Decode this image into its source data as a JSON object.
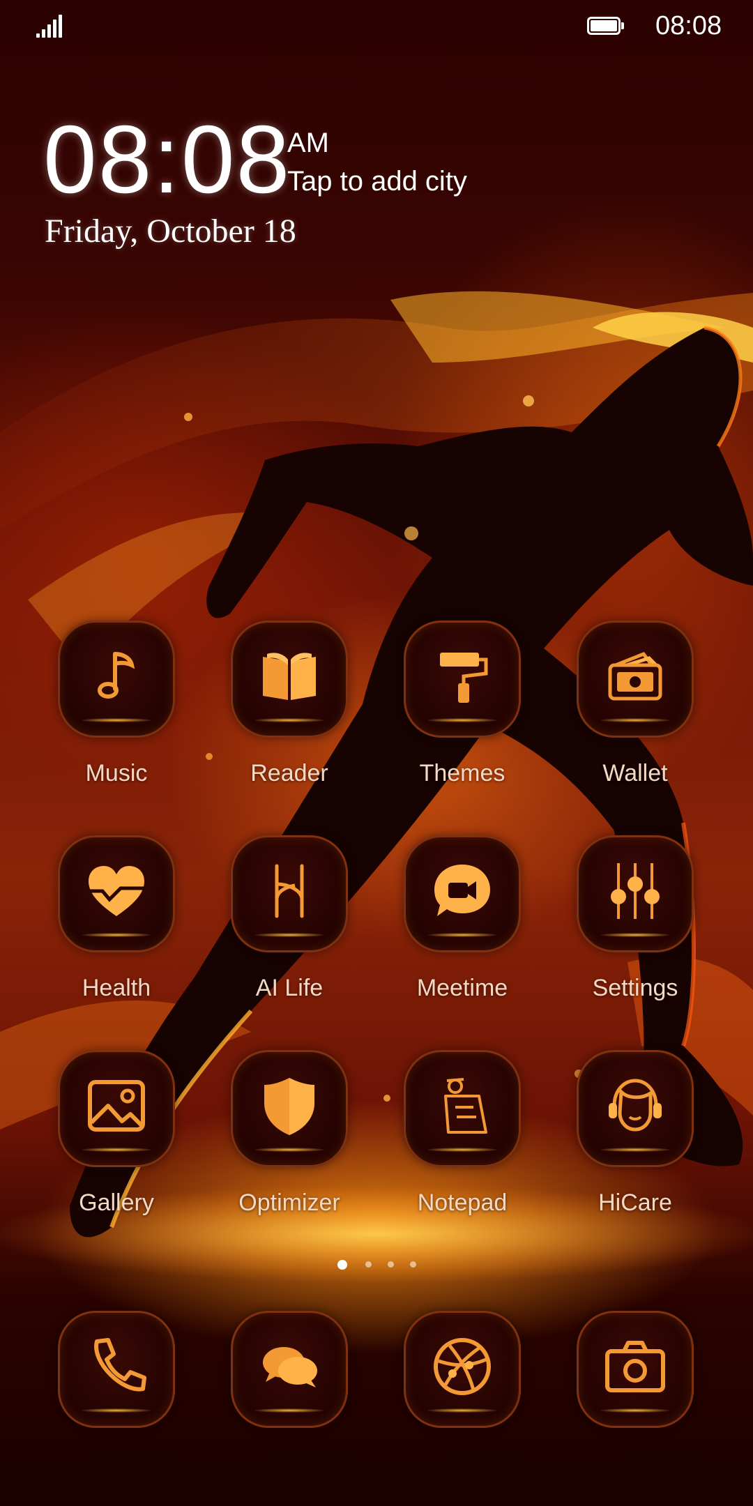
{
  "status_bar": {
    "time": "08:08",
    "signal_icon": "signal-bars-icon",
    "battery_icon": "battery-full-icon"
  },
  "clock_widget": {
    "time": "08:08",
    "ampm": "AM",
    "city_prompt": "Tap to add city",
    "date": "Friday, October 18"
  },
  "apps": [
    {
      "label": "Music",
      "icon": "music-note-icon"
    },
    {
      "label": "Reader",
      "icon": "open-book-icon"
    },
    {
      "label": "Themes",
      "icon": "paint-roller-icon"
    },
    {
      "label": "Wallet",
      "icon": "wallet-icon"
    },
    {
      "label": "Health",
      "icon": "heart-icon"
    },
    {
      "label": "AI Life",
      "icon": "ai-life-icon"
    },
    {
      "label": "Meetime",
      "icon": "video-chat-icon"
    },
    {
      "label": "Settings",
      "icon": "sliders-icon"
    },
    {
      "label": "Gallery",
      "icon": "image-icon"
    },
    {
      "label": "Optimizer",
      "icon": "shield-icon"
    },
    {
      "label": "Notepad",
      "icon": "notepad-icon"
    },
    {
      "label": "HiCare",
      "icon": "headset-icon"
    }
  ],
  "page_indicator": {
    "pages": 4,
    "current": 1
  },
  "dock": [
    {
      "icon": "phone-icon"
    },
    {
      "icon": "messages-icon"
    },
    {
      "icon": "browser-icon"
    },
    {
      "icon": "camera-icon"
    }
  ],
  "colors": {
    "accent": "#f7a83a",
    "icon_orange": "#f39a35",
    "label": "#f6d9c4"
  }
}
